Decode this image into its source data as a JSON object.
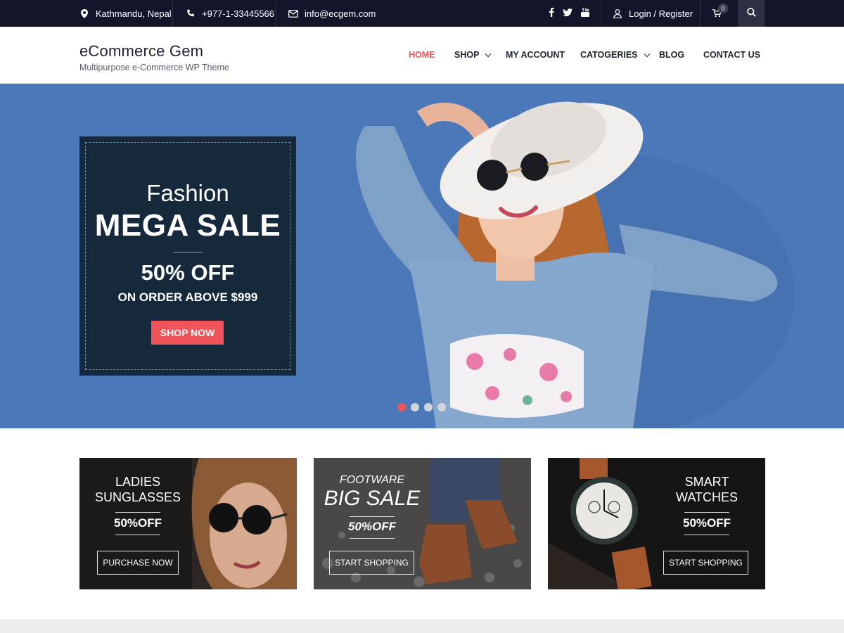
{
  "topbar": {
    "location": "Kathmandu, Nepal",
    "phone": "+977-1-33445566",
    "email": "info@ecgem.com",
    "social": [
      "f",
      "t",
      "yt"
    ],
    "login": "Login / Register",
    "cart_count": "0"
  },
  "header": {
    "title": "eCommerce Gem",
    "tagline": "Multipurpose e-Commerce WP Theme",
    "nav": [
      {
        "label": "HOME",
        "active": true
      },
      {
        "label": "SHOP",
        "dropdown": true
      },
      {
        "label": "MY ACCOUNT"
      },
      {
        "label": "CATOGERIES",
        "dropdown": true
      },
      {
        "label": "BLOG"
      },
      {
        "label": "CONTACT US"
      }
    ]
  },
  "hero": {
    "line1": "Fashion",
    "line2": "MEGA SALE",
    "line3": "50% OFF",
    "line4": "ON ORDER ABOVE $999",
    "button": "SHOP NOW",
    "slides": 4,
    "active_slide": 1
  },
  "cards": [
    {
      "title1": "LADIES",
      "title2": "SUNGLASSES",
      "offer": "50%OFF",
      "button": "PURCHASE NOW"
    },
    {
      "title1": "FOOTWARE",
      "title2": "BIG SALE",
      "offer": "50%OFF",
      "button": "START SHOPPING"
    },
    {
      "title1": "SMART",
      "title2": "WATCHES",
      "offer": "50%OFF",
      "button": "START SHOPPING"
    }
  ],
  "colors": {
    "accent": "#f0545a",
    "dark": "#13152a",
    "hero_bg": "#4b78b8",
    "promo_bg": "#16283c"
  }
}
